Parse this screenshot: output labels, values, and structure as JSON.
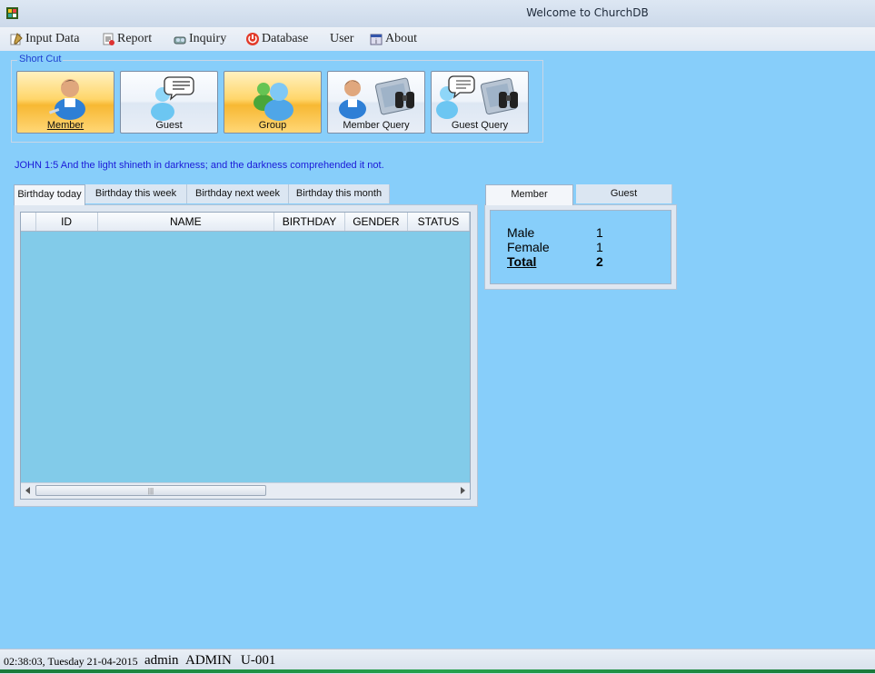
{
  "window": {
    "title": "Welcome to ChurchDB"
  },
  "menu": [
    {
      "label": "Input Data",
      "icon": "input-data-icon"
    },
    {
      "label": "Report",
      "icon": "report-icon"
    },
    {
      "label": "Inquiry",
      "icon": "inquiry-icon"
    },
    {
      "label": "Database",
      "icon": "database-power-icon"
    },
    {
      "label": "User",
      "icon": ""
    },
    {
      "label": "About",
      "icon": "about-icon"
    }
  ],
  "shortcut": {
    "legend": "Short Cut",
    "buttons": [
      {
        "label": "Member",
        "icon": "member-icon"
      },
      {
        "label": "Guest",
        "icon": "guest-icon"
      },
      {
        "label": "Group",
        "icon": "group-icon"
      },
      {
        "label": "Member Query",
        "icon": "member-query-icon"
      },
      {
        "label": "Guest Query",
        "icon": "guest-query-icon"
      }
    ]
  },
  "verse": "JOHN 1:5 And the light shineth in darkness; and the darkness comprehended it not.",
  "birthday_tabs": [
    "Birthday today",
    "Birthday this week",
    "Birthday next week",
    "Birthday this month"
  ],
  "birthday_grid": {
    "columns": [
      "ID",
      "NAME",
      "BIRTHDAY",
      "GENDER",
      "STATUS"
    ],
    "rows": [],
    "scroll_thumb": "|||"
  },
  "stats_tabs": [
    "Member",
    "Guest"
  ],
  "stats": {
    "male_label": "Male",
    "male_value": "1",
    "female_label": "Female",
    "female_value": "1",
    "total_label": "Total",
    "total_value": "2"
  },
  "status_bar": {
    "clock": "02:38:03, Tuesday 21-04-2015",
    "user": "admin",
    "role": "ADMIN",
    "user_id": "U-001"
  },
  "colors": {
    "background": "#87cefa",
    "grid_background": "#82cbe9",
    "verse_text": "#1a1ad8",
    "legend_text": "#1f3fd0"
  }
}
